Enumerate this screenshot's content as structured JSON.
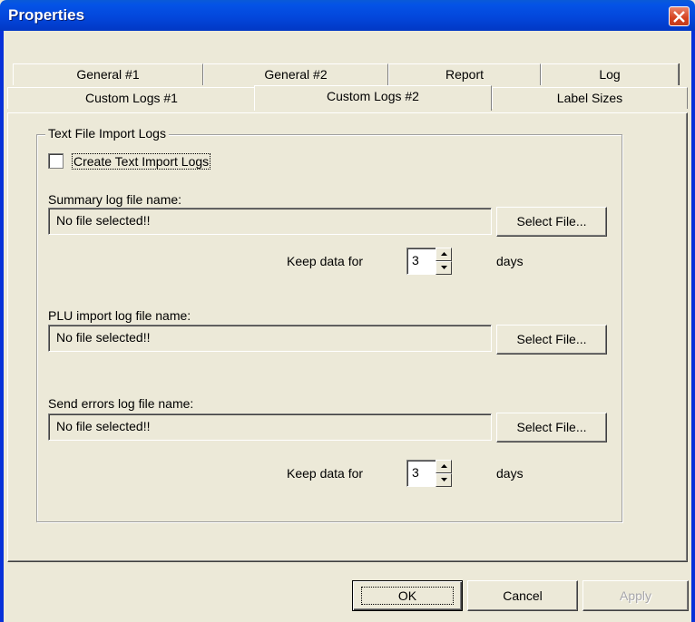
{
  "window": {
    "title": "Properties"
  },
  "tabs": {
    "row1": [
      "General #1",
      "General #2",
      "Report",
      "Log"
    ],
    "row2": [
      "Custom Logs #1",
      "Custom Logs #2",
      "Label Sizes"
    ],
    "active": "Custom Logs #2"
  },
  "group": {
    "title": "Text File Import Logs",
    "create_checkbox": {
      "label": "Create Text Import Logs",
      "checked": false
    }
  },
  "summary": {
    "label": "Summary log file name:",
    "value": "No file selected!!",
    "button": "Select File...",
    "keep_label": "Keep data for",
    "keep_value": "3",
    "keep_unit": "days"
  },
  "plu": {
    "label": "PLU import log file name:",
    "value": "No file selected!!",
    "button": "Select File..."
  },
  "send_errors": {
    "label": "Send errors log file name:",
    "value": "No file selected!!",
    "button": "Select File...",
    "keep_label": "Keep data for",
    "keep_value": "3",
    "keep_unit": "days"
  },
  "footer": {
    "ok": "OK",
    "cancel": "Cancel",
    "apply": "Apply"
  }
}
